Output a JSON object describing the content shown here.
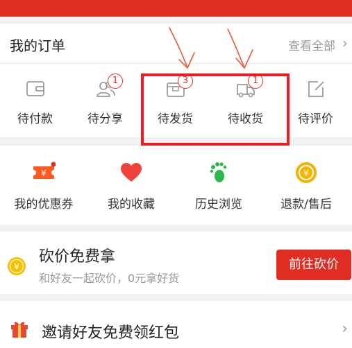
{
  "orders": {
    "title": "我的订单",
    "view_all": "查看全部",
    "items": [
      {
        "label": "待付款",
        "icon": "wallet-icon",
        "badge": null
      },
      {
        "label": "待分享",
        "icon": "group-share-icon",
        "badge": "1"
      },
      {
        "label": "待发货",
        "icon": "package-icon",
        "badge": "3"
      },
      {
        "label": "待收货",
        "icon": "truck-icon",
        "badge": "1"
      },
      {
        "label": "待评价",
        "icon": "edit-icon",
        "badge": null
      }
    ]
  },
  "services": {
    "items": [
      {
        "label": "我的优惠券",
        "icon": "coupon-icon",
        "color": "#ff5a1f"
      },
      {
        "label": "我的收藏",
        "icon": "heart-icon",
        "color": "#f0413c"
      },
      {
        "label": "历史浏览",
        "icon": "footprint-icon",
        "color": "#2db84b"
      },
      {
        "label": "退款/售后",
        "icon": "refund-coin-icon",
        "color": "#f5b301"
      }
    ]
  },
  "bargain": {
    "title": "砍价免费拿",
    "subtitle": "和好友一起砍价，0元拿好货",
    "button": "前往砍价"
  },
  "invite": {
    "title": "邀请好友免费领红包"
  },
  "colors": {
    "brand_red": "#e02e24",
    "annotation_red": "#ee1b24"
  }
}
